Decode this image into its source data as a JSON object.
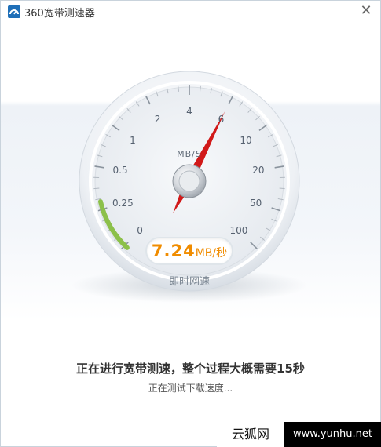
{
  "window": {
    "title": "360宽带测速器",
    "close_glyph": "✕",
    "icon": "app-logo-icon"
  },
  "gauge": {
    "unit": "MB/S",
    "ticks": [
      "0",
      "0.25",
      "0.5",
      "1",
      "2",
      "4",
      "6",
      "10",
      "20",
      "50",
      "100"
    ],
    "needle_value": 6,
    "speed_value": "7.24",
    "speed_unit": "MB/秒",
    "caption": "即时网速",
    "accent_color": "#f08c00",
    "needle_color": "#d11919",
    "progress_color": "#8cc04a"
  },
  "status": {
    "main": "正在进行宽带测速，整个过程大概需要15秒",
    "sub": "正在测试下载速度..."
  },
  "watermark": {
    "left": "云狐网",
    "right": "www.yunhu.net"
  }
}
